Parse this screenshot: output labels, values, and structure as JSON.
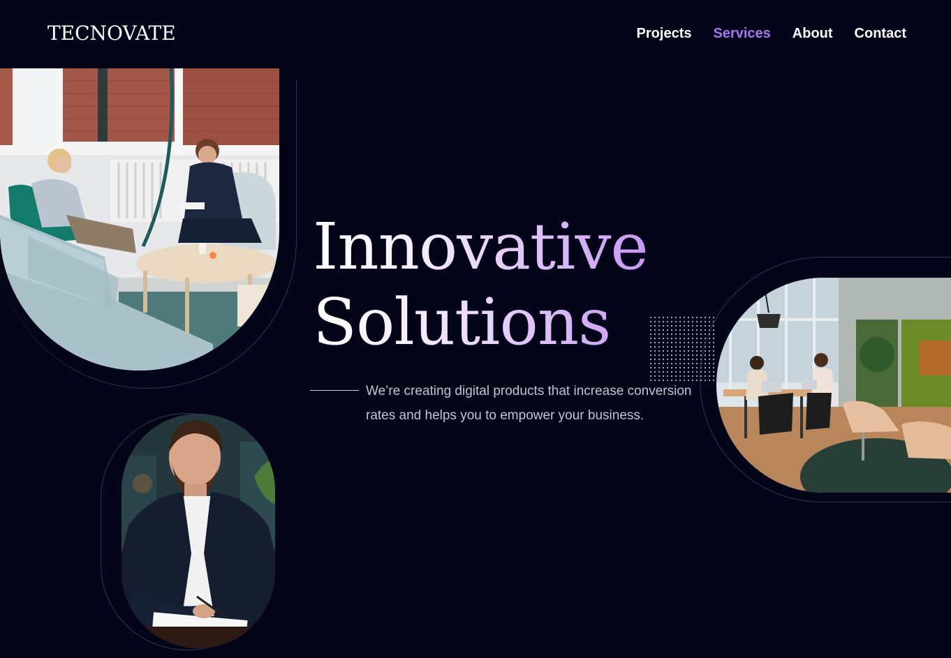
{
  "header": {
    "logo": "TECNOVATE",
    "nav": [
      {
        "label": "Projects",
        "active": false
      },
      {
        "label": "Services",
        "active": true
      },
      {
        "label": "About",
        "active": false
      },
      {
        "label": "Contact",
        "active": false
      }
    ]
  },
  "hero": {
    "title_line1": "Innovative",
    "title_line2": "Solutions",
    "description": "We’re creating digital products that increase conversion rates and helps you to empower your business."
  },
  "colors": {
    "background": "#05051a",
    "accent": "#a775f0",
    "text": "#ffffff",
    "muted_text": "#c4c4cf"
  }
}
